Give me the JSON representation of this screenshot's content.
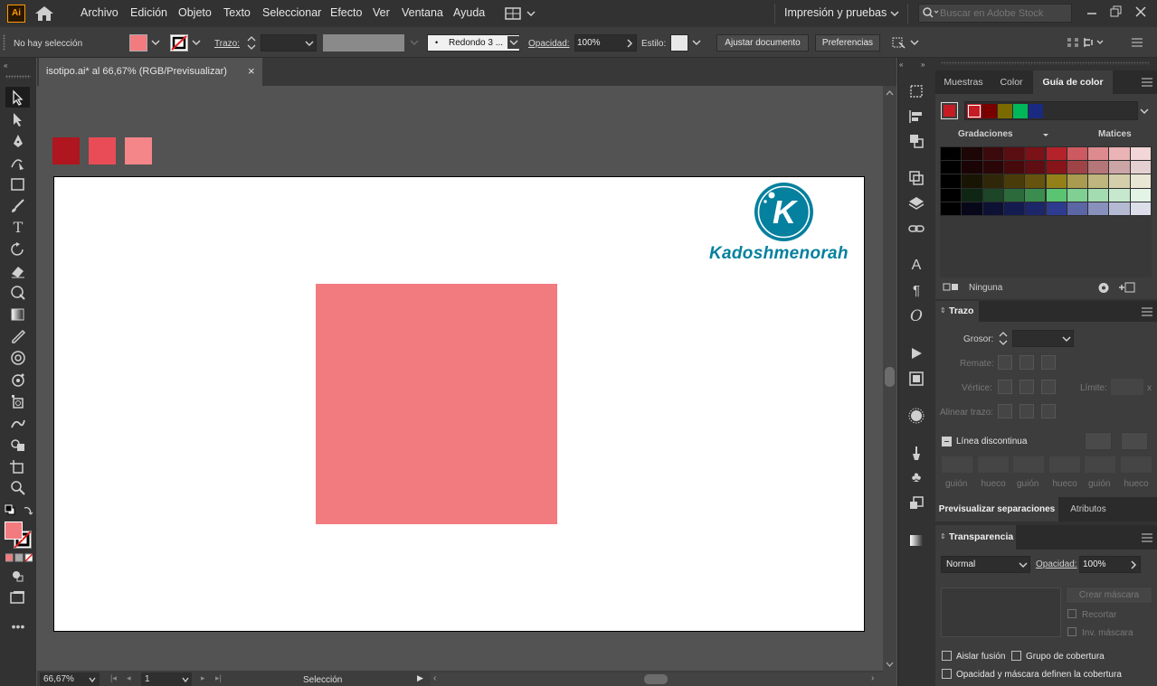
{
  "app": {
    "logo": "Ai"
  },
  "menu": [
    "Archivo",
    "Edición",
    "Objeto",
    "Texto",
    "Seleccionar",
    "Efecto",
    "Ver",
    "Ventana",
    "Ayuda"
  ],
  "workspace": "Impresión y pruebas",
  "search": {
    "placeholder": "Buscar en Adobe Stock"
  },
  "control": {
    "selection": "No hay selección",
    "fill_color": "#f27b80",
    "stroke_label": "Trazo:",
    "brush": "Redondo 3 ...",
    "opacity_label": "Opacidad:",
    "opacity_value": "100%",
    "style_label": "Estilo:",
    "adjust_btn": "Ajustar documento",
    "prefs_btn": "Preferencias"
  },
  "document": {
    "tab_title": "isotipo.ai* al 66,67% (RGB/Previsualizar)",
    "close": "×"
  },
  "canvas": {
    "swatches": [
      "#b0161f",
      "#e94c56",
      "#f48589"
    ],
    "square_color": "#f27b80",
    "logo_text": "Kadoshmenorah",
    "logo_letter": "K",
    "logo_color": "#05809e"
  },
  "status": {
    "zoom": "66,67%",
    "page": "1",
    "tool": "Selección"
  },
  "panels": {
    "tabs": [
      "Muestras",
      "Color",
      "Guía de color"
    ],
    "color_guide": {
      "harmony": [
        "#c71b23",
        "#7a0000",
        "#7a6a00",
        "#00b85a",
        "#1a2a80"
      ],
      "gradations_label": "Gradaciones",
      "tints_label": "Matices",
      "none_label": "Ninguna",
      "grid": [
        [
          "#000000",
          "#1c0606",
          "#3c0a0c",
          "#5a0e12",
          "#7a1218",
          "#b5222a",
          "#cd5a60",
          "#de8b8f",
          "#eab3b5",
          "#f3d6d7"
        ],
        [
          "#000000",
          "#1a0405",
          "#2b0608",
          "#460a0d",
          "#5e0d12",
          "#871419",
          "#9e4447",
          "#b57679",
          "#cca5a6",
          "#e4d0d1"
        ],
        [
          "#000000",
          "#191505",
          "#302708",
          "#4a3c0a",
          "#66530d",
          "#938019",
          "#a99b4f",
          "#bfb57e",
          "#d4cfaa",
          "#e9e6d4"
        ],
        [
          "#000000",
          "#0f2615",
          "#1d4527",
          "#2c6a3c",
          "#3a8d4f",
          "#5ac473",
          "#7fd092",
          "#a3dcb0",
          "#c6e9ce",
          "#e3f4e7"
        ],
        [
          "#000000",
          "#06081a",
          "#0d1133",
          "#141b4f",
          "#1c2668",
          "#2e3c8f",
          "#5b66a5",
          "#8890bc",
          "#b5bad3",
          "#dcdfea"
        ]
      ]
    },
    "stroke": {
      "title": "Trazo",
      "weight_label": "Grosor:",
      "cap_label": "Remate:",
      "corner_label": "Vértice:",
      "limit_label": "Límite:",
      "align_label": "Alinear trazo:",
      "dashed_label": "Línea discontinua",
      "dash_fields": [
        "guión",
        "hueco",
        "guión",
        "hueco",
        "guión",
        "hueco"
      ]
    },
    "sep_tabs": [
      "Previsualizar separaciones",
      "Atributos"
    ],
    "transparency": {
      "title": "Transparencia",
      "mode": "Normal",
      "opacity_label": "Opacidad:",
      "opacity_value": "100%",
      "mask_btn": "Crear máscara",
      "clip_label": "Recortar",
      "invert_label": "Inv. máscara",
      "isolate_label": "Aislar fusión",
      "knockout_label": "Grupo de cobertura",
      "opacity_mask_label": "Opacidad y máscara definen la cobertura"
    }
  }
}
